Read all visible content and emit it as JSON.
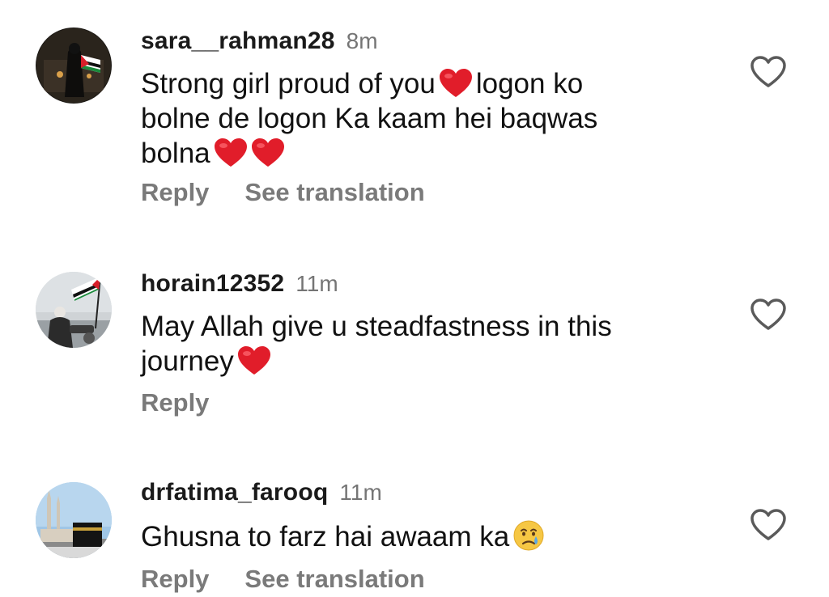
{
  "icons": {
    "like": "heart-outline-icon",
    "heart_emoji": "red-heart-emoji",
    "tear_emoji": "crying-face-emoji"
  },
  "colors": {
    "username": "#1a1a1a",
    "timestamp": "#757575",
    "action": "#7a7a7a",
    "heart_emoji": "#e11d2a"
  },
  "comments": [
    {
      "username": "sara__rahman28",
      "time": "8m",
      "text_parts": [
        "Strong girl proud of you",
        "logon ko bolne de logon Ka kaam hei baqwas bolna"
      ],
      "actions": {
        "reply": "Reply",
        "translate": "See translation"
      }
    },
    {
      "username": "horain12352",
      "time": "11m",
      "text_parts": [
        "May Allah give u steadfastness in this journey"
      ],
      "actions": {
        "reply": "Reply"
      }
    },
    {
      "username": "drfatima_farooq",
      "time": "11m",
      "text_parts": [
        "Ghusna to farz hai awaam ka"
      ],
      "actions": {
        "reply": "Reply",
        "translate": "See translation"
      }
    }
  ]
}
